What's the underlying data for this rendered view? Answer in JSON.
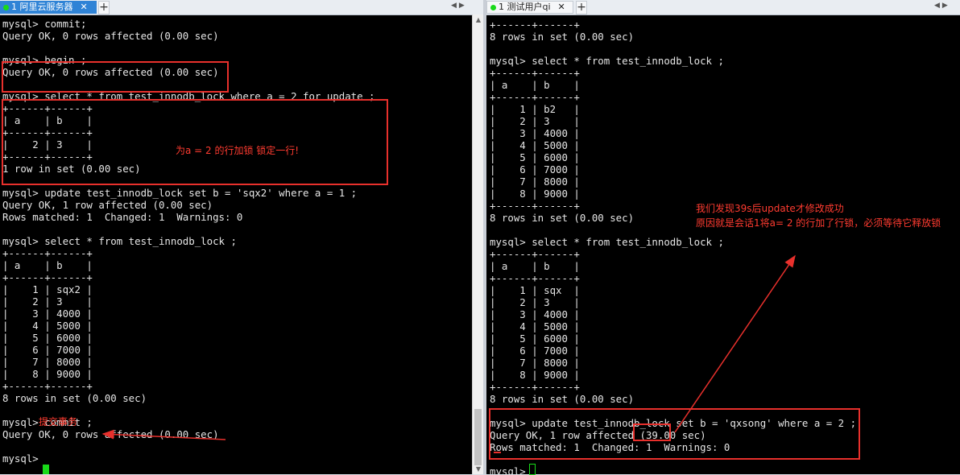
{
  "left_window": {
    "tab": {
      "label": "1 阿里云服务器",
      "status_color": "#19d919"
    },
    "terminal_text": "mysql> commit;\nQuery OK, 0 rows affected (0.00 sec)\n\nmysql> begin ;\nQuery OK, 0 rows affected (0.00 sec)\n\nmysql> select * from test_innodb_lock where a = 2 for update ;\n+------+------+\n| a    | b    |\n+------+------+\n|    2 | 3    |\n+------+------+\n1 row in set (0.00 sec)\n\nmysql> update test_innodb_lock set b = 'sqx2' where a = 1 ;\nQuery OK, 1 row affected (0.00 sec)\nRows matched: 1  Changed: 1  Warnings: 0\n\nmysql> select * from test_innodb_lock ;\n+------+------+\n| a    | b    |\n+------+------+\n|    1 | sqx2 |\n|    2 | 3    |\n|    3 | 4000 |\n|    4 | 5000 |\n|    5 | 6000 |\n|    6 | 7000 |\n|    7 | 8000 |\n|    8 | 9000 |\n+------+------+\n8 rows in set (0.00 sec)\n\nmysql> commit ;\nQuery OK, 0 rows affected (0.00 sec)\n\nmysql> ",
    "annotations": {
      "lock_note": "为a = 2 的行加锁    锁定一行!",
      "commit_note": "提交事务"
    }
  },
  "right_window": {
    "tab": {
      "label": "1 测试用户qi",
      "status_color": "#19d919"
    },
    "terminal_text": "+------+------+\n8 rows in set (0.00 sec)\n\nmysql> select * from test_innodb_lock ;\n+------+------+\n| a    | b    |\n+------+------+\n|    1 | b2   |\n|    2 | 3    |\n|    3 | 4000 |\n|    4 | 5000 |\n|    5 | 6000 |\n|    6 | 7000 |\n|    7 | 8000 |\n|    8 | 9000 |\n+------+------+\n8 rows in set (0.00 sec)\n\nmysql> select * from test_innodb_lock ;\n+------+------+\n| a    | b    |\n+------+------+\n|    1 | sqx  |\n|    2 | 3    |\n|    3 | 4000 |\n|    4 | 5000 |\n|    5 | 6000 |\n|    6 | 7000 |\n|    7 | 8000 |\n|    8 | 9000 |\n+------+------+\n8 rows in set (0.00 sec)\n\nmysql> update test_innodb_lock set b = 'qxsong' where a = 2 ;\nQuery OK, 1 row affected (39.00 sec)\nRows matched: 1  Changed: 1  Warnings: 0\n\nmysql> ",
    "annotations": {
      "line1": "我们发现39s后update才修改成功",
      "line2": "原因就是会话1将a= 2 的行加了行锁，必须等待它释放锁"
    }
  },
  "colors": {
    "annotation": "#e8302c",
    "cursor": "#19d919",
    "tab_active": "#2f83d6"
  }
}
